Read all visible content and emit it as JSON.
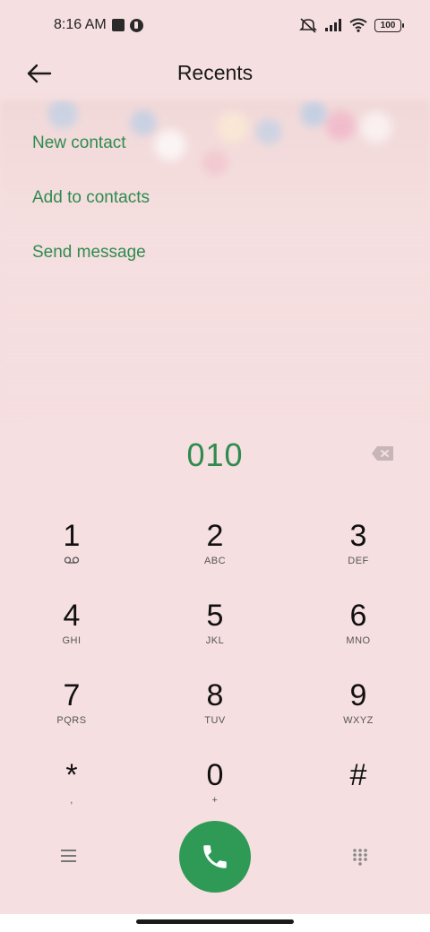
{
  "status_bar": {
    "time": "8:16 AM",
    "icons": [
      "notification-square-icon",
      "app-notification-icon",
      "mute-icon",
      "signal-icon",
      "wifi-icon"
    ],
    "battery": "100"
  },
  "header": {
    "title": "Recents",
    "back_icon": "arrow-left-icon"
  },
  "actions": [
    {
      "label": "New contact"
    },
    {
      "label": "Add to contacts"
    },
    {
      "label": "Send message"
    }
  ],
  "dialer": {
    "number": "010",
    "accent_color": "#2e8b4f",
    "call_button_color": "#2f9a55",
    "keys": [
      {
        "digit": "1",
        "letters": ""
      },
      {
        "digit": "2",
        "letters": "ABC"
      },
      {
        "digit": "3",
        "letters": "DEF"
      },
      {
        "digit": "4",
        "letters": "GHI"
      },
      {
        "digit": "5",
        "letters": "JKL"
      },
      {
        "digit": "6",
        "letters": "MNO"
      },
      {
        "digit": "7",
        "letters": "PQRS"
      },
      {
        "digit": "8",
        "letters": "TUV"
      },
      {
        "digit": "9",
        "letters": "WXYZ"
      },
      {
        "digit": "*",
        "letters": ","
      },
      {
        "digit": "0",
        "letters": "+"
      },
      {
        "digit": "#",
        "letters": ""
      }
    ]
  }
}
